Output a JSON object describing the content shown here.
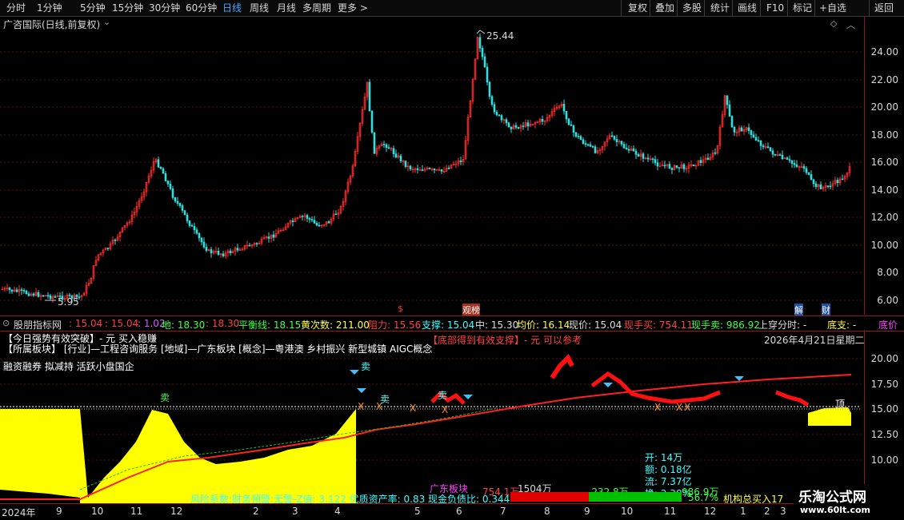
{
  "toolbar": {
    "periods": [
      "分时",
      "1分钟",
      "5分钟",
      "15分钟",
      "30分钟",
      "60分钟",
      "日线",
      "周线",
      "月线",
      "多周期",
      "更多 >"
    ],
    "active_period": "日线",
    "right_buttons": [
      "复权",
      "叠加",
      "多股",
      "统计",
      "画线",
      "F10",
      "标记",
      "+自选",
      "返回"
    ]
  },
  "main": {
    "title": "广咨国际(日线,前复权)",
    "high_label": "25.44",
    "low_label": "5.95",
    "axis_ticks": [
      "24.00",
      "22.00",
      "20.00",
      "18.00",
      "16.00",
      "14.00",
      "12.00",
      "10.00",
      "8.00",
      "6.00"
    ],
    "marks": [
      "$",
      "观榜",
      "解",
      "财"
    ]
  },
  "indicator_bar": {
    "name": "股朋指标网",
    "values": [
      {
        "text": ": 15.04",
        "color": "#ff4040"
      },
      {
        "text": ": 15.04",
        "color": "#ff4040"
      },
      {
        "text": ": 1.02",
        "color": "#d060ff"
      },
      {
        "text": "地: 18.30",
        "color": "#40ff40"
      },
      {
        "text": ": 18.30",
        "color": "#ff4040"
      },
      {
        "text": "平衡线: 18.15",
        "color": "#40ff40"
      },
      {
        "text": "黄次数: 211.00",
        "color": "#ffff40"
      },
      {
        "text": "阻力: 15.56",
        "color": "#ff4040"
      },
      {
        "text": "支撑: 15.04",
        "color": "#40ffff"
      },
      {
        "text": "中: 15.30",
        "color": "#dddddd"
      },
      {
        "text": "均价: 16.14",
        "color": "#ffff40"
      },
      {
        "text": "现价: 15.04",
        "color": "#dddddd"
      },
      {
        "text": "现手买: 754.11",
        "color": "#ff4040"
      },
      {
        "text": "现手卖: 986.92",
        "color": "#40ff40"
      },
      {
        "text": "上穿分时: -",
        "color": "#dddddd"
      },
      {
        "text": "底支: -",
        "color": "#ffff40"
      },
      {
        "text": "底价",
        "color": "#ff40ff"
      }
    ]
  },
  "lower": {
    "line1": "【今日强势有效突破】- 元 买入稳赚",
    "line2": "【所属板块】  [行业]—工程咨询服务   [地域]—广东板块   [概念]—粤港澳 乡村振兴 新型城镇 AIGC概念",
    "line3": "融资融券 拟减持 活跃小盘国企",
    "line4": "【底部得到有效支撑】- 元 可以参考",
    "date_text": "2026年4月21日星期二",
    "axis_ticks": [
      "20.00",
      "17.50",
      "15.00",
      "12.50",
      "10.00"
    ],
    "stats": [
      "开: 14万",
      "额: 0.18亿",
      "流: 7.37亿",
      "换: 2.38%"
    ],
    "bottom_text": "风险系数:财务预警:无警-Z值: 3.122 优质资产率: 0.83 现金负债比: 0.344",
    "sector": "广东板块",
    "buy_val": "754.1万",
    "total_val": "1504万",
    "net_val": "-232.8万",
    "sell_val": "986.9万",
    "pct": "56.7%",
    "inst": "机构总买入17",
    "sell_mark": "卖",
    "top_mark": "顶"
  },
  "date_axis": [
    "2024年",
    "9",
    "10",
    "11",
    "12",
    "2",
    "3",
    "4",
    "5",
    "6",
    "7",
    "8",
    "9",
    "10",
    "11",
    "12",
    "1",
    "2",
    "3"
  ],
  "watermark": {
    "cn": "乐淘公式网",
    "url": "www.60lt.com"
  }
}
